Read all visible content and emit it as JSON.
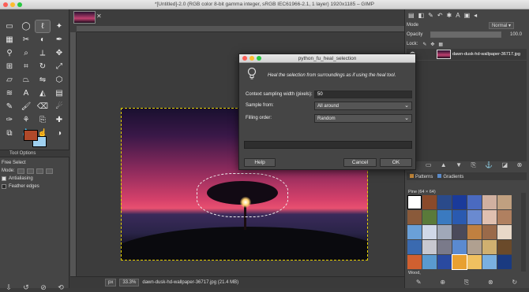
{
  "window": {
    "title": "*[Untitled]-2.0 (RGB color 8-bit gamma integer, sRGB IEC61966-2.1, 1 layer) 1920x1185 – GIMP"
  },
  "toolbox": {
    "tool_options_label": "Tool Options",
    "tool_name": "Free Select",
    "mode_label": "Mode:",
    "antialiasing_label": "Antialiasing",
    "feather_label": "Feather edges",
    "fg_color": "#b0492a",
    "bg_color": "#9fd0f0"
  },
  "statusbar": {
    "unit": "px",
    "zoom": "33.3%",
    "file_info": "dawn-dusk-hd-wallpaper-36717.jpg (21.4 MB)"
  },
  "dock": {
    "mode_label": "Mode",
    "mode_value": "Normal",
    "opacity_label": "Opacity",
    "opacity_value": "100.0",
    "opacity_fraction": 1.0,
    "lock_label": "Lock:",
    "layer_name": "dawn-dusk-hd-wallpaper-36717.jpg",
    "tabs": {
      "patterns": "Patterns",
      "gradients": "Gradients"
    },
    "pattern_name": "Pine (64 × 64)",
    "pattern_footer": "Wood,"
  },
  "dialog": {
    "title": "python_fu_heal_selection",
    "description": "Heal the selection from surroundings as if using the heal tool.",
    "context_label": "Context sampling width (pixels):",
    "context_value": "50",
    "sample_label": "Sample from:",
    "sample_value": "All around",
    "filling_label": "Filling order:",
    "filling_value": "Random",
    "help_label": "Help",
    "cancel_label": "Cancel",
    "ok_label": "OK"
  }
}
